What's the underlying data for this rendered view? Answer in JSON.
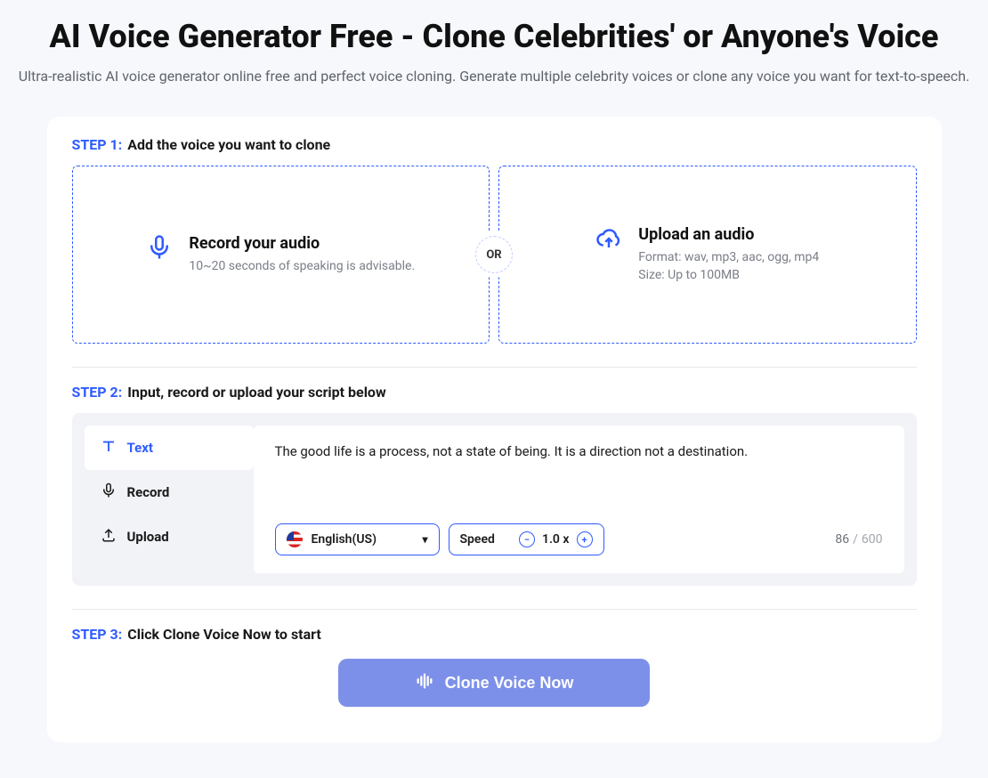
{
  "header": {
    "title": "AI Voice Generator Free - Clone Celebrities' or Anyone's Voice",
    "subtitle": "Ultra-realistic AI voice generator online free and perfect voice cloning. Generate multiple celebrity voices or clone any voice you want for text-to-speech."
  },
  "step1": {
    "label": "STEP 1:",
    "text": "Add the voice you want to clone",
    "or": "OR",
    "record": {
      "title": "Record your audio",
      "hint": "10~20 seconds of speaking is advisable."
    },
    "upload": {
      "title": "Upload an audio",
      "format": "Format: wav, mp3, aac, ogg, mp4",
      "size": "Size: Up to 100MB"
    }
  },
  "step2": {
    "label": "STEP 2:",
    "text": "Input, record or upload your script below",
    "tabs": {
      "text": "Text",
      "record": "Record",
      "upload": "Upload"
    },
    "script": "The good life is a process, not a state of being. It is a direction not a destination.",
    "language": "English(US)",
    "speed_label": "Speed",
    "speed_value": "1.0 x",
    "count_current": "86",
    "count_sep": "/",
    "count_max": "600"
  },
  "step3": {
    "label": "STEP 3:",
    "text": "Click Clone Voice Now to start",
    "cta": "Clone Voice Now"
  }
}
